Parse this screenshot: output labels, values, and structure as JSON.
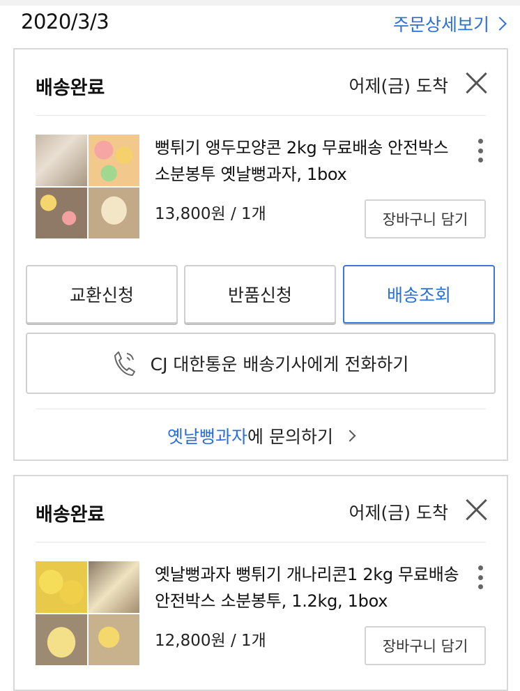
{
  "header": {
    "date": "2020/3/3",
    "detail_link": "주문상세보기"
  },
  "orders": [
    {
      "status": "배송완료",
      "arrival": "어제(금) 도착",
      "product_name": "뻥튀기 앵두모양콘 2kg 무료배송 안전박스 소분봉투 옛날뻥과자, 1box",
      "price_qty": "13,800원 / 1개",
      "cart_button": "장바구니 담기",
      "actions": [
        "교환신청",
        "반품신청",
        "배송조회"
      ],
      "call_button": "CJ 대한통운 배송기사에게 전화하기",
      "seller": "옛날뻥과자",
      "inquiry_suffix": "에 문의하기"
    },
    {
      "status": "배송완료",
      "arrival": "어제(금) 도착",
      "product_name": "옛날뻥과자 뻥튀기 개나리콘1 2kg 무료배송 안전박스 소분봉투, 1.2kg, 1box",
      "price_qty": "12,800원 / 1개",
      "cart_button": "장바구니 담기"
    }
  ],
  "colors": {
    "accent": "#2b6fd8",
    "border": "#d8d8d8"
  },
  "icons": [
    "chevron-right-icon",
    "close-icon",
    "more-vertical-icon",
    "phone-icon"
  ]
}
